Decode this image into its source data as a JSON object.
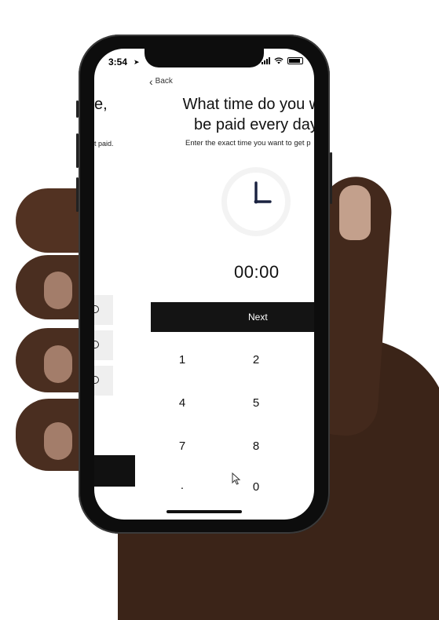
{
  "status_bar": {
    "time": "3:54"
  },
  "previous_screen": {
    "title_fragment": "e,",
    "subtitle_fragment": "t paid."
  },
  "nav": {
    "back_label": "Back"
  },
  "screen": {
    "title": "What time do you wa\nbe paid every day",
    "subtitle": "Enter the exact time you want to get p",
    "time_value": "00:00",
    "next_label": "Next"
  },
  "keypad": {
    "keys": [
      "1",
      "2",
      "4",
      "5",
      "7",
      "8",
      ".",
      "0"
    ]
  },
  "colors": {
    "button_bg": "#141414",
    "screen_bg": "#ffffff",
    "clock_ring": "#f3f3f3",
    "clock_hands": "#1a2240"
  }
}
